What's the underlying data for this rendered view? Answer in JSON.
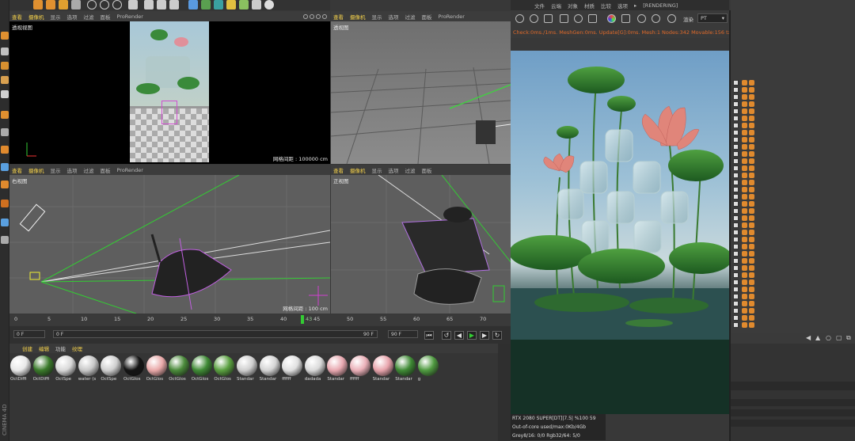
{
  "viewport_menu": {
    "items": [
      "查看",
      "摄像机",
      "显示",
      "选项",
      "过滤",
      "面板",
      "ProRender"
    ],
    "highlight": [
      0,
      1
    ]
  },
  "viewports": {
    "perspective": {
      "label": "透视视图",
      "grid_info": "网格间距 : 100000 cm"
    },
    "top": {
      "label": "透视图"
    },
    "right": {
      "label": "右视图",
      "grid_info": "网格间距 : 100 cm"
    },
    "front": {
      "label": "正视图"
    }
  },
  "timeline": {
    "ticks": [
      "0",
      "5",
      "10",
      "15",
      "20",
      "25",
      "30",
      "35",
      "40",
      "45",
      "50",
      "55",
      "60",
      "65",
      "70"
    ],
    "current_frame_marker": "43",
    "start_field": "0 F",
    "min_field": "0 F",
    "max_field": "90 F",
    "end_field": "90 F"
  },
  "material_menu": [
    "创建",
    "编辑",
    "功能",
    "纹理"
  ],
  "materials": [
    {
      "name": "OctDiffi",
      "color": "#e8e8e8"
    },
    {
      "name": "OctDiffi",
      "color": "#3a7a2a"
    },
    {
      "name": "OctSpe",
      "color": "#d8d8d8"
    },
    {
      "name": "water (s",
      "color": "#c8c8c8"
    },
    {
      "name": "OctSpe",
      "color": "#d0d0d0"
    },
    {
      "name": "OctGlos",
      "color": "#151515"
    },
    {
      "name": "OctGlos",
      "color": "#e9a9a9"
    },
    {
      "name": "OctGlos",
      "color": "#4a8a3a"
    },
    {
      "name": "OctGlos",
      "color": "#3f8a35"
    },
    {
      "name": "OctGlos",
      "color": "#5aa040"
    },
    {
      "name": "Standar",
      "color": "#cfcfcf"
    },
    {
      "name": "Standar",
      "color": "#d4d4d4"
    },
    {
      "name": "ffffff",
      "color": "#e0e0e0"
    },
    {
      "name": "dadada",
      "color": "#dadada"
    },
    {
      "name": "Standar",
      "color": "#e8a8b0"
    },
    {
      "name": "ffffff",
      "color": "#eab0b8"
    },
    {
      "name": "Standar",
      "color": "#e8a4ac"
    },
    {
      "name": "Standar",
      "color": "#3f8a35"
    },
    {
      "name": "g",
      "color": "#4f9a40"
    }
  ],
  "app_logo": "CINEMA 4D",
  "render_window": {
    "title": "[RENDERING]",
    "menu": [
      "文件",
      "云端",
      "对象",
      "材质",
      "比较",
      "选项",
      "▸"
    ],
    "mode_label": "渲染",
    "mode_value": "PT",
    "status": "Check:0ms./1ms. MeshGen:0ms. Update[G]:0ms. Mesh:1 Nodes:342 Movable:156 txCached",
    "info": [
      "RTX 2080 SUPER[DT]|7.5|   %100     59",
      "Out-of-core used/max:0Kb/4Gb",
      "Grey8/16: 0/0          Rgb32/64: 5/0"
    ]
  }
}
